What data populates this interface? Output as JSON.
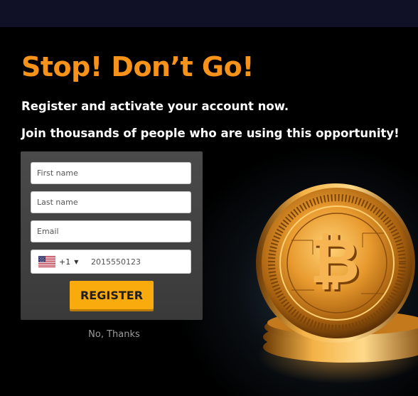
{
  "popup": {
    "headline": "Stop! Don’t Go!",
    "subline1": "Register and activate your account now.",
    "subline2": "Join thousands of people who are using this opportunity!"
  },
  "form": {
    "first_name_placeholder": "First name",
    "last_name_placeholder": "Last name",
    "email_placeholder": "Email",
    "country_flag_icon": "us-flag-icon",
    "dial_code": "+1",
    "dropdown_caret": "▼",
    "phone_value": "2015550123",
    "register_label": "REGISTER"
  },
  "dismiss": {
    "label": "No, Thanks"
  },
  "colors": {
    "accent": "#f7931a",
    "button": "#f9aa0c",
    "top_bar": "#101027",
    "form_panel": "#444444",
    "background": "#000000"
  },
  "decoration": {
    "image": "bitcoin-coin-icon"
  }
}
